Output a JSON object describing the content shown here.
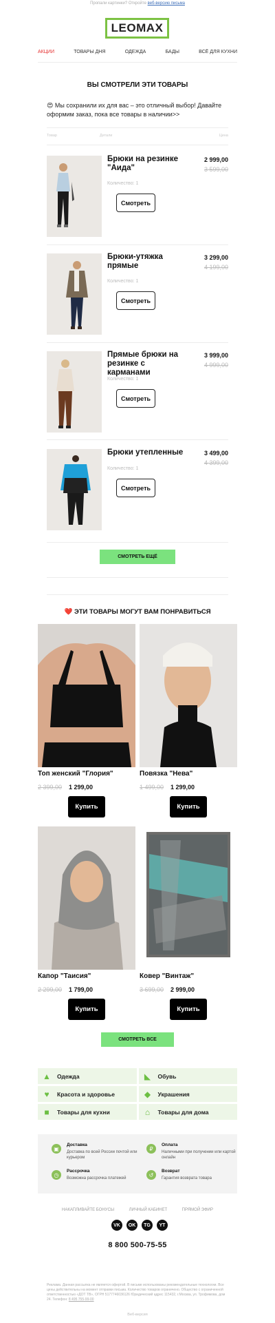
{
  "preheader": {
    "text": "Пропали картинки? Откройте ",
    "link": "веб-версию письма"
  },
  "brand": {
    "name": "LEOMAX",
    "accent": "#7cc243"
  },
  "nav": [
    "АКЦИИ",
    "ТОВАРЫ ДНЯ",
    "ОДЕЖДА",
    "БАДЫ",
    "ВСЁ ДЛЯ КУХНИ"
  ],
  "viewed": {
    "title": "ВЫ СМОТРЕЛИ ЭТИ ТОВАРЫ",
    "intro_emoji": "😍",
    "intro": "Мы сохранили их для вас – это отличный выбор! Давайте оформим заказ, пока все товары в наличии>>",
    "columns": [
      "Товар",
      "Детали",
      "Цена"
    ],
    "items": [
      {
        "name": "Брюки на резинке \"Аида\"",
        "qty": "Количество: 1",
        "price": "2 999,00",
        "old": "3 599,00",
        "button": "Смотреть"
      },
      {
        "name": "Брюки-утяжка прямые",
        "qty": "Количество: 1",
        "price": "3 299,00",
        "old": "4 199,00",
        "button": "Смотреть"
      },
      {
        "name": "Прямые брюки на резинке с карманами",
        "qty": "Количество: 1",
        "price": "3 999,00",
        "old": "4 999,00",
        "button": "Смотреть"
      },
      {
        "name": "Брюки утепленные",
        "qty": "Количество: 1",
        "price": "3 499,00",
        "old": "4 399,00",
        "button": "Смотреть"
      }
    ],
    "more_button": "СМОТРЕТЬ ЕЩЁ"
  },
  "recs": {
    "heart": "❤️",
    "title": "ЭТИ ТОВАРЫ МОГУТ ВАМ ПОНРАВИТЬСЯ",
    "items": [
      {
        "name": "Топ женский \"Глория\"",
        "old": "2 399,00",
        "price": "1 299,00",
        "button": "Купить"
      },
      {
        "name": "Повязка \"Нева\"",
        "old": "1 499,00",
        "price": "1 299,00",
        "button": "Купить"
      },
      {
        "name": "Капор \"Таисия\"",
        "old": "2 299,00",
        "price": "1 799,00",
        "button": "Купить"
      },
      {
        "name": "Ковер \"Винтаж\"",
        "old": "3 699,00",
        "price": "2 999,00",
        "button": "Купить"
      }
    ],
    "all_button": "СМОТРЕТЬ ВСЕ"
  },
  "categories": [
    {
      "label": "Одежда",
      "icon": "dress-icon"
    },
    {
      "label": "Обувь",
      "icon": "shoe-icon"
    },
    {
      "label": "Красота и здоровье",
      "icon": "heart-plus-icon"
    },
    {
      "label": "Украшения",
      "icon": "diamond-icon"
    },
    {
      "label": "Товары для кухни",
      "icon": "pot-icon"
    },
    {
      "label": "Товары для дома",
      "icon": "house-icon"
    }
  ],
  "info": [
    {
      "title": "Доставка",
      "desc": "Доставка по всей России почтой или курьером",
      "icon": "box-icon"
    },
    {
      "title": "Оплата",
      "desc": "Наличными при получении или картой онлайн",
      "icon": "ruble-icon"
    },
    {
      "title": "Рассрочка",
      "desc": "Возможна рассрочка платежей",
      "icon": "clock-icon"
    },
    {
      "title": "Возврат",
      "desc": "Гарантия возврата товара",
      "icon": "return-icon"
    }
  ],
  "footer_links": [
    "НАКАПЛИВАЙТЕ БОНУСЫ",
    "ЛИЧНЫЙ КАБИНЕТ",
    "ПРЯМОЙ ЭФИР"
  ],
  "social": [
    "VK",
    "OK",
    "TG",
    "YT"
  ],
  "phone": "8 800 500-75-55",
  "legal": "Реклама. Данная рассылка не является офертой. В письме использованы рекомендательные технологии. Все цены действительны на момент отправки письма. Количество товаров ограничено. Общество с ограниченной ответственностью «ДОТ ТВ», ОГРН 5177746036126 Юридический адрес 115432, г.Москва, ул. Трофимова, дом 24. Телефон:",
  "legal_phone": "8 495 755-99-00",
  "web_version": "Веб-версия"
}
